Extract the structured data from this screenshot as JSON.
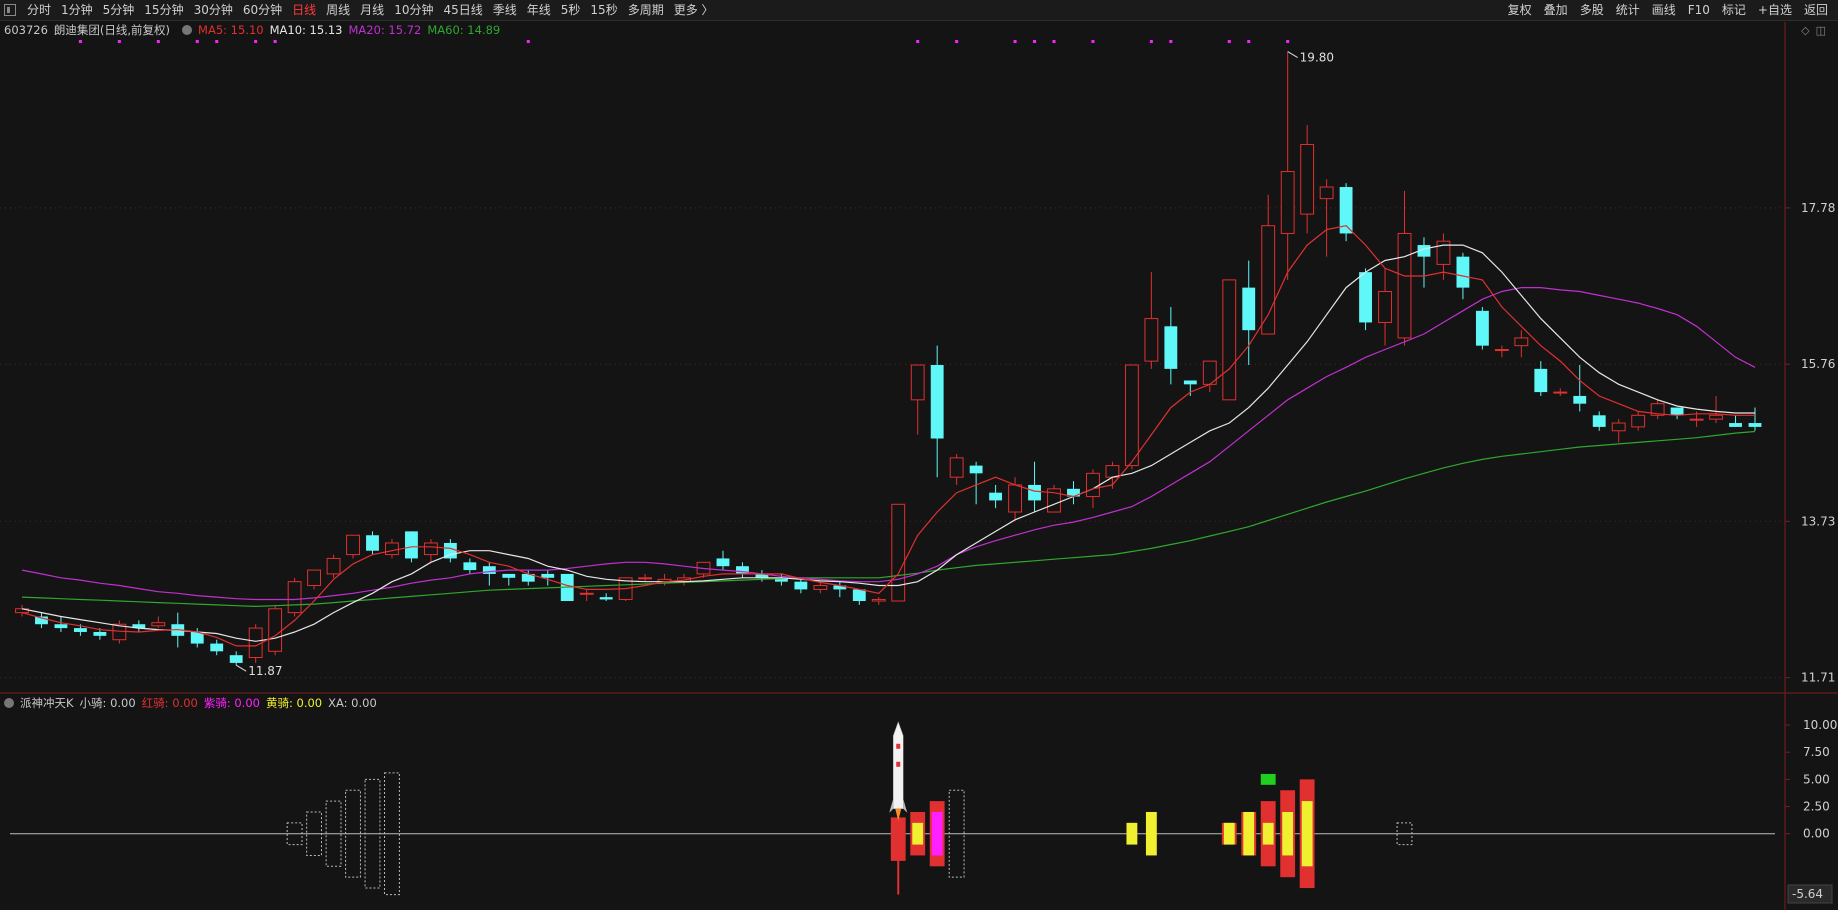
{
  "toolbar": {
    "periods": [
      "分时",
      "1分钟",
      "5分钟",
      "15分钟",
      "30分钟",
      "60分钟",
      "日线",
      "周线",
      "月线",
      "10分钟",
      "45日线",
      "季线",
      "年线",
      "5秒",
      "15秒",
      "多周期",
      "更多 〉"
    ],
    "active_period": "日线",
    "right_items": [
      "复权",
      "叠加",
      "多股",
      "统计",
      "画线",
      "F10",
      "标记",
      "+自选",
      "返回"
    ]
  },
  "main_info": {
    "code": "603726",
    "name": "朗迪集团",
    "mode": "(日线,前复权)",
    "ma5_label": "MA5: 15.10",
    "ma10_label": "MA10: 15.13",
    "ma20_label": "MA20: 15.72",
    "ma60_label": "MA60: 14.89"
  },
  "indicator_info": {
    "name": "派神冲天K",
    "small_label": "小骑: 0.00",
    "red_label": "红骑: 0.00",
    "purple_label": "紫骑: 0.00",
    "yellow_label": "黄骑: 0.00",
    "xa_label": "XA: 0.00"
  },
  "colors": {
    "up": "#e03030",
    "down": "#5ff7f7",
    "ma5": "#e03030",
    "ma10": "#e6e6e6",
    "ma20": "#c030d0",
    "ma60": "#2ea82e",
    "yellow": "#f0f030",
    "magenta": "#ff20ff",
    "green_box": "#20d020"
  },
  "chart_data": [
    {
      "type": "candlestick",
      "price_axis_ticks": [
        11.71,
        13.73,
        15.76,
        17.78
      ],
      "price_axis_labels": [
        "11.71",
        "13.73",
        "15.76",
        "17.78"
      ],
      "ylim": [
        11.55,
        19.95
      ],
      "high_annotation": {
        "value": 19.8,
        "label": "19.80"
      },
      "low_annotation": {
        "value": 11.87,
        "label": "11.87"
      },
      "candles": [
        [
          12.55,
          12.6,
          12.5,
          12.65
        ],
        [
          12.5,
          12.4,
          12.35,
          12.55
        ],
        [
          12.4,
          12.35,
          12.3,
          12.5
        ],
        [
          12.35,
          12.3,
          12.25,
          12.4
        ],
        [
          12.3,
          12.25,
          12.2,
          12.35
        ],
        [
          12.2,
          12.4,
          12.15,
          12.45
        ],
        [
          12.4,
          12.35,
          12.3,
          12.45
        ],
        [
          12.38,
          12.42,
          12.35,
          12.5
        ],
        [
          12.4,
          12.25,
          12.1,
          12.55
        ],
        [
          12.3,
          12.15,
          12.1,
          12.35
        ],
        [
          12.15,
          12.05,
          12.0,
          12.2
        ],
        [
          12.0,
          11.9,
          11.87,
          12.05
        ],
        [
          11.97,
          12.35,
          11.9,
          12.4
        ],
        [
          12.05,
          12.6,
          12.0,
          12.65
        ],
        [
          12.55,
          12.95,
          12.5,
          13.0
        ],
        [
          12.9,
          13.1,
          12.85,
          13.1
        ],
        [
          13.05,
          13.25,
          13.0,
          13.3
        ],
        [
          13.3,
          13.55,
          13.25,
          13.55
        ],
        [
          13.55,
          13.35,
          13.3,
          13.6
        ],
        [
          13.3,
          13.45,
          13.25,
          13.5
        ],
        [
          13.6,
          13.25,
          13.2,
          13.6
        ],
        [
          13.3,
          13.45,
          13.2,
          13.5
        ],
        [
          13.45,
          13.25,
          13.2,
          13.5
        ],
        [
          13.2,
          13.1,
          13.05,
          13.25
        ],
        [
          13.15,
          13.05,
          12.9,
          13.2
        ],
        [
          13.05,
          13.0,
          12.9,
          13.05
        ],
        [
          13.05,
          12.95,
          12.9,
          13.1
        ],
        [
          13.05,
          13.0,
          12.9,
          13.1
        ],
        [
          13.05,
          12.7,
          12.7,
          13.05
        ],
        [
          12.8,
          12.8,
          12.7,
          12.85
        ],
        [
          12.75,
          12.72,
          12.7,
          12.8
        ],
        [
          12.72,
          13.0,
          12.7,
          13.0
        ],
        [
          13.0,
          13.0,
          12.95,
          13.05
        ],
        [
          12.95,
          12.98,
          12.9,
          13.05
        ],
        [
          12.95,
          13.0,
          12.9,
          13.05
        ],
        [
          13.05,
          13.2,
          13.0,
          13.2
        ],
        [
          13.25,
          13.15,
          13.1,
          13.35
        ],
        [
          13.15,
          13.05,
          13.0,
          13.2
        ],
        [
          13.05,
          13.0,
          12.95,
          13.1
        ],
        [
          13.0,
          12.95,
          12.9,
          13.05
        ],
        [
          12.95,
          12.85,
          12.8,
          13.0
        ],
        [
          12.85,
          12.9,
          12.8,
          12.95
        ],
        [
          12.9,
          12.85,
          12.75,
          12.95
        ],
        [
          12.85,
          12.7,
          12.65,
          12.85
        ],
        [
          12.7,
          12.72,
          12.65,
          12.75
        ],
        [
          12.7,
          13.95,
          12.7,
          13.95
        ],
        [
          15.3,
          15.75,
          14.85,
          15.75
        ],
        [
          15.75,
          14.8,
          14.3,
          16.0
        ],
        [
          14.3,
          14.55,
          14.2,
          14.6
        ],
        [
          14.45,
          14.35,
          13.95,
          14.5
        ],
        [
          14.1,
          14.0,
          13.9,
          14.2
        ],
        [
          13.85,
          14.2,
          13.75,
          14.3
        ],
        [
          14.2,
          14.0,
          13.85,
          14.5
        ],
        [
          13.85,
          14.15,
          13.85,
          14.2
        ],
        [
          14.15,
          14.05,
          13.95,
          14.25
        ],
        [
          14.05,
          14.35,
          13.9,
          14.4
        ],
        [
          14.3,
          14.45,
          14.15,
          14.5
        ],
        [
          14.45,
          15.75,
          14.4,
          15.75
        ],
        [
          15.8,
          16.35,
          15.7,
          16.95
        ],
        [
          16.25,
          15.7,
          15.5,
          16.5
        ],
        [
          15.55,
          15.5,
          15.35,
          15.55
        ],
        [
          15.5,
          15.8,
          15.4,
          15.8
        ],
        [
          15.3,
          16.85,
          15.3,
          16.85
        ],
        [
          16.75,
          16.2,
          15.75,
          17.1
        ],
        [
          16.15,
          17.55,
          16.15,
          17.95
        ],
        [
          17.45,
          18.25,
          16.85,
          19.8
        ],
        [
          17.7,
          18.6,
          17.45,
          18.85
        ],
        [
          17.9,
          18.05,
          17.15,
          18.15
        ],
        [
          18.05,
          17.45,
          17.35,
          18.1
        ],
        [
          16.95,
          16.3,
          16.2,
          17.0
        ],
        [
          16.3,
          16.7,
          16.0,
          17.0
        ],
        [
          16.1,
          17.45,
          16.0,
          18.0
        ],
        [
          17.3,
          17.15,
          16.75,
          17.4
        ],
        [
          17.05,
          17.35,
          16.85,
          17.45
        ],
        [
          17.15,
          16.75,
          16.6,
          17.2
        ],
        [
          16.45,
          16.0,
          15.95,
          16.5
        ],
        [
          15.95,
          15.95,
          15.85,
          16.0
        ],
        [
          16.0,
          16.1,
          15.85,
          16.2
        ],
        [
          15.7,
          15.4,
          15.35,
          15.8
        ],
        [
          15.4,
          15.4,
          15.35,
          15.45
        ],
        [
          15.35,
          15.25,
          15.15,
          15.75
        ],
        [
          15.1,
          14.95,
          14.9,
          15.15
        ],
        [
          14.9,
          15.0,
          14.75,
          15.05
        ],
        [
          14.95,
          15.1,
          14.9,
          15.15
        ],
        [
          15.1,
          15.25,
          15.05,
          15.3
        ],
        [
          15.2,
          15.1,
          15.05,
          15.2
        ],
        [
          15.05,
          15.05,
          14.95,
          15.15
        ],
        [
          15.05,
          15.1,
          15.0,
          15.35
        ],
        [
          15.0,
          14.95,
          14.95,
          15.1
        ],
        [
          15.0,
          14.95,
          14.9,
          15.2
        ]
      ],
      "ma5": [
        12.55,
        12.48,
        12.42,
        12.38,
        12.33,
        12.31,
        12.3,
        12.32,
        12.33,
        12.3,
        12.23,
        12.12,
        12.12,
        12.25,
        12.45,
        12.7,
        12.98,
        13.18,
        13.3,
        13.35,
        13.4,
        13.4,
        13.38,
        13.3,
        13.2,
        13.15,
        13.05,
        12.98,
        12.9,
        12.85,
        12.85,
        12.86,
        12.9,
        12.95,
        12.97,
        13.02,
        13.05,
        13.05,
        13.05,
        13.05,
        12.99,
        12.94,
        12.9,
        12.85,
        12.8,
        13.05,
        13.55,
        13.85,
        14.1,
        14.2,
        14.3,
        14.2,
        14.12,
        14.1,
        14.05,
        14.15,
        14.2,
        14.5,
        14.85,
        15.2,
        15.4,
        15.5,
        15.7,
        16.0,
        16.4,
        16.95,
        17.3,
        17.5,
        17.55,
        17.3,
        17.0,
        16.9,
        16.9,
        16.95,
        16.9,
        16.85,
        16.5,
        16.25,
        16.0,
        15.8,
        15.55,
        15.35,
        15.25,
        15.15,
        15.12,
        15.1,
        15.12,
        15.12,
        15.1,
        15.1
      ],
      "ma10": [
        12.6,
        12.55,
        12.5,
        12.46,
        12.42,
        12.38,
        12.35,
        12.33,
        12.32,
        12.3,
        12.28,
        12.22,
        12.18,
        12.22,
        12.3,
        12.4,
        12.55,
        12.68,
        12.8,
        12.95,
        13.05,
        13.2,
        13.3,
        13.35,
        13.35,
        13.3,
        13.25,
        13.15,
        13.1,
        13.02,
        12.98,
        12.96,
        12.95,
        12.95,
        12.95,
        12.96,
        12.98,
        13.0,
        13.0,
        13.0,
        12.98,
        12.96,
        12.95,
        12.93,
        12.9,
        12.9,
        12.95,
        13.1,
        13.3,
        13.45,
        13.6,
        13.75,
        13.85,
        13.95,
        14.05,
        14.15,
        14.3,
        14.35,
        14.45,
        14.6,
        14.75,
        14.9,
        15.0,
        15.2,
        15.45,
        15.75,
        16.05,
        16.4,
        16.75,
        16.95,
        17.1,
        17.15,
        17.25,
        17.3,
        17.3,
        17.2,
        16.95,
        16.65,
        16.35,
        16.1,
        15.85,
        15.65,
        15.5,
        15.4,
        15.3,
        15.22,
        15.18,
        15.15,
        15.13,
        15.13
      ],
      "ma20": [
        13.1,
        13.05,
        13.0,
        12.97,
        12.93,
        12.9,
        12.86,
        12.82,
        12.8,
        12.77,
        12.75,
        12.73,
        12.72,
        12.72,
        12.72,
        12.74,
        12.77,
        12.8,
        12.84,
        12.88,
        12.93,
        12.97,
        13.0,
        13.05,
        13.08,
        13.1,
        13.1,
        13.1,
        13.12,
        13.15,
        13.18,
        13.2,
        13.2,
        13.18,
        13.15,
        13.12,
        13.1,
        13.08,
        13.05,
        13.02,
        13.0,
        12.98,
        12.96,
        12.95,
        12.95,
        12.98,
        13.05,
        13.15,
        13.3,
        13.4,
        13.48,
        13.55,
        13.62,
        13.68,
        13.72,
        13.78,
        13.85,
        13.92,
        14.05,
        14.2,
        14.35,
        14.5,
        14.7,
        14.9,
        15.1,
        15.3,
        15.45,
        15.6,
        15.72,
        15.85,
        15.95,
        16.05,
        16.15,
        16.3,
        16.45,
        16.6,
        16.7,
        16.75,
        16.75,
        16.72,
        16.7,
        16.65,
        16.6,
        16.55,
        16.48,
        16.4,
        16.25,
        16.05,
        15.85,
        15.72
      ],
      "ma60": [
        12.75,
        12.74,
        12.73,
        12.72,
        12.71,
        12.7,
        12.69,
        12.68,
        12.67,
        12.66,
        12.65,
        12.64,
        12.63,
        12.64,
        12.65,
        12.66,
        12.68,
        12.7,
        12.72,
        12.74,
        12.76,
        12.78,
        12.8,
        12.82,
        12.84,
        12.85,
        12.86,
        12.87,
        12.88,
        12.89,
        12.9,
        12.91,
        12.92,
        12.93,
        12.94,
        12.95,
        12.96,
        12.97,
        12.98,
        12.99,
        13.0,
        13.0,
        13.0,
        13.0,
        13.0,
        13.03,
        13.06,
        13.1,
        13.13,
        13.16,
        13.18,
        13.2,
        13.22,
        13.24,
        13.26,
        13.28,
        13.3,
        13.34,
        13.38,
        13.43,
        13.48,
        13.54,
        13.6,
        13.66,
        13.74,
        13.82,
        13.9,
        13.98,
        14.05,
        14.12,
        14.2,
        14.28,
        14.35,
        14.42,
        14.48,
        14.53,
        14.57,
        14.6,
        14.63,
        14.66,
        14.69,
        14.71,
        14.73,
        14.75,
        14.77,
        14.79,
        14.81,
        14.84,
        14.87,
        14.89
      ],
      "magenta_markers": [
        3,
        5,
        7,
        9,
        10,
        12,
        13,
        26,
        46,
        48,
        51,
        52,
        53,
        55,
        58,
        59,
        62,
        63,
        65
      ]
    },
    {
      "type": "indicator_bars",
      "axis_ticks": [
        10.0,
        7.5,
        5.0,
        2.5,
        0.0
      ],
      "axis_labels": [
        "10.00",
        "7.50",
        "5.00",
        "2.50",
        "0.00"
      ],
      "bottom_label": "-5.64",
      "ylim": [
        -5.64,
        11.2
      ],
      "outline_bars": [
        {
          "i": 14,
          "lo": -1,
          "hi": 1
        },
        {
          "i": 15,
          "lo": -2,
          "hi": 2
        },
        {
          "i": 16,
          "lo": -3,
          "hi": 3
        },
        {
          "i": 17,
          "lo": -4,
          "hi": 4
        },
        {
          "i": 18,
          "lo": -5,
          "hi": 5
        },
        {
          "i": 19,
          "lo": -5.6,
          "hi": 5.6
        },
        {
          "i": 48,
          "lo": -4,
          "hi": 4
        },
        {
          "i": 71,
          "lo": -1,
          "hi": 1
        }
      ],
      "red_bars": [
        {
          "i": 45,
          "lo": -2.5,
          "hi": 1.5
        },
        {
          "i": 46,
          "lo": -2,
          "hi": 2
        },
        {
          "i": 47,
          "lo": -3,
          "hi": 3
        },
        {
          "i": 62,
          "lo": -1,
          "hi": 1
        },
        {
          "i": 63,
          "lo": -2,
          "hi": 2
        },
        {
          "i": 64,
          "lo": -3,
          "hi": 3
        },
        {
          "i": 65,
          "lo": -4,
          "hi": 4
        },
        {
          "i": 66,
          "lo": -5,
          "hi": 5
        }
      ],
      "yellow_bars": [
        {
          "i": 46,
          "lo": -1,
          "hi": 1
        },
        {
          "i": 57,
          "lo": -1,
          "hi": 1
        },
        {
          "i": 58,
          "lo": -2,
          "hi": 2
        },
        {
          "i": 62,
          "lo": -1,
          "hi": 1
        },
        {
          "i": 63,
          "lo": -2,
          "hi": 2
        },
        {
          "i": 64,
          "lo": -1,
          "hi": 1
        },
        {
          "i": 65,
          "lo": -2,
          "hi": 2
        },
        {
          "i": 66,
          "lo": -3,
          "hi": 3
        }
      ],
      "magenta_bars": [
        {
          "i": 47,
          "lo": -2,
          "hi": 2
        }
      ],
      "green_box": {
        "i": 64,
        "lo": 4.5,
        "hi": 5.5
      },
      "rocket_index": 45
    }
  ]
}
